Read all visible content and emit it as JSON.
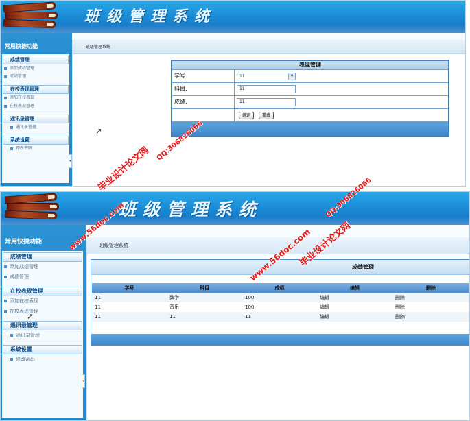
{
  "app_title": "班级管理系统",
  "sidebar": {
    "title": "常用快捷功能",
    "groups": [
      {
        "label": "成绩管理",
        "items": [
          "添加成绩管理",
          "成绩管理"
        ]
      },
      {
        "label": "在校表现管理",
        "items": [
          "添加在校表现",
          "在校表现管理"
        ]
      },
      {
        "label": "通讯录管理",
        "items": [
          "通讯录管理"
        ]
      },
      {
        "label": "系统设置",
        "items": [
          "修改密码"
        ]
      }
    ]
  },
  "breadcrumb": "班级管理系统",
  "performance_form": {
    "title": "表现管理",
    "fields": [
      {
        "label": "学号",
        "value": "11"
      },
      {
        "label": "科目:",
        "value": "11"
      },
      {
        "label": "成绩:",
        "value": "11"
      }
    ],
    "confirm_label": "确定",
    "reset_label": "重填"
  },
  "grade_table": {
    "title": "成绩管理",
    "headers": [
      "学号",
      "科目",
      "成绩",
      "编辑",
      "删除"
    ],
    "rows": [
      [
        "11",
        "数学",
        "100",
        "编辑",
        "删除"
      ],
      [
        "11",
        "音乐",
        "100",
        "编辑",
        "删除"
      ],
      [
        "11",
        "11",
        "11",
        "编辑",
        "删除"
      ]
    ]
  },
  "watermarks": {
    "site_name": "毕业设计论文网",
    "url": "www.56doc.com",
    "qq": "QQ:306826066"
  },
  "colors": {
    "banner_blue": "#1c8ed8",
    "sidebar_blue": "#2088c8",
    "table_header_blue": "#4e8ccd",
    "watermark_red": "#e51c1c"
  }
}
